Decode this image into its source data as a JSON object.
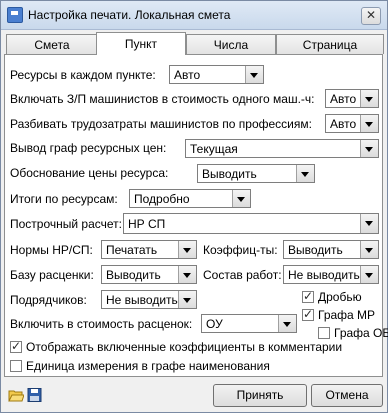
{
  "window": {
    "title": "Настройка печати. Локальная смета",
    "close_glyph": "✕"
  },
  "tabs": [
    {
      "label": "Смета"
    },
    {
      "label": "Пункт"
    },
    {
      "label": "Числа"
    },
    {
      "label": "Страница"
    }
  ],
  "form": {
    "resources_each_point": {
      "label": "Ресурсы в каждом пункте:",
      "value": "Авто"
    },
    "include_zp": {
      "label": "Включать З/П машинистов в стоимость одного маш.-ч:",
      "value": "Авто"
    },
    "split_labor": {
      "label": "Разбивать трудозатраты машинистов по профессиям:",
      "value": "Авто"
    },
    "resource_price_columns": {
      "label": "Вывод граф ресурсных цен:",
      "value": "Текущая"
    },
    "price_justification": {
      "label": "Обоснование цены ресурса:",
      "value": "Выводить"
    },
    "resource_totals": {
      "label": "Итоги по ресурсам:",
      "value": "Подробно"
    },
    "line_calc": {
      "label": "Построчный расчет:",
      "value": "НР СП"
    },
    "norms_nr_sp": {
      "label": "Нормы НР/СП:",
      "value": "Печатать"
    },
    "coefficients": {
      "label": "Коэффиц-ты:",
      "value": "Выводить"
    },
    "rate_base": {
      "label": "Базу расценки:",
      "value": "Выводить"
    },
    "work_composition": {
      "label": "Состав работ:",
      "value": "Не выводить"
    },
    "contractors": {
      "label": "Подрядчиков:",
      "value": "Не выводить"
    },
    "include_in_rate_cost": {
      "label": "Включить в стоимость расценок:",
      "value": "ОУ"
    },
    "fraction": {
      "label": "Дробью",
      "checked": true
    },
    "column_mr": {
      "label": "Графа МР",
      "checked": true
    },
    "column_ob": {
      "label": "Графа ОБ",
      "checked": false
    },
    "show_coef_in_comments": {
      "label": "Отображать включенные коэффициенты в комментарии",
      "checked": true
    },
    "unit_in_name_column": {
      "label": "Единица измерения в графе наименования",
      "checked": false
    }
  },
  "footer": {
    "ok_label": "Принять",
    "cancel_label": "Отмена"
  },
  "colors": {
    "titlebar": "#c9d9ec",
    "panel": "#ffffff",
    "window_bg": "#f0f0f0"
  }
}
